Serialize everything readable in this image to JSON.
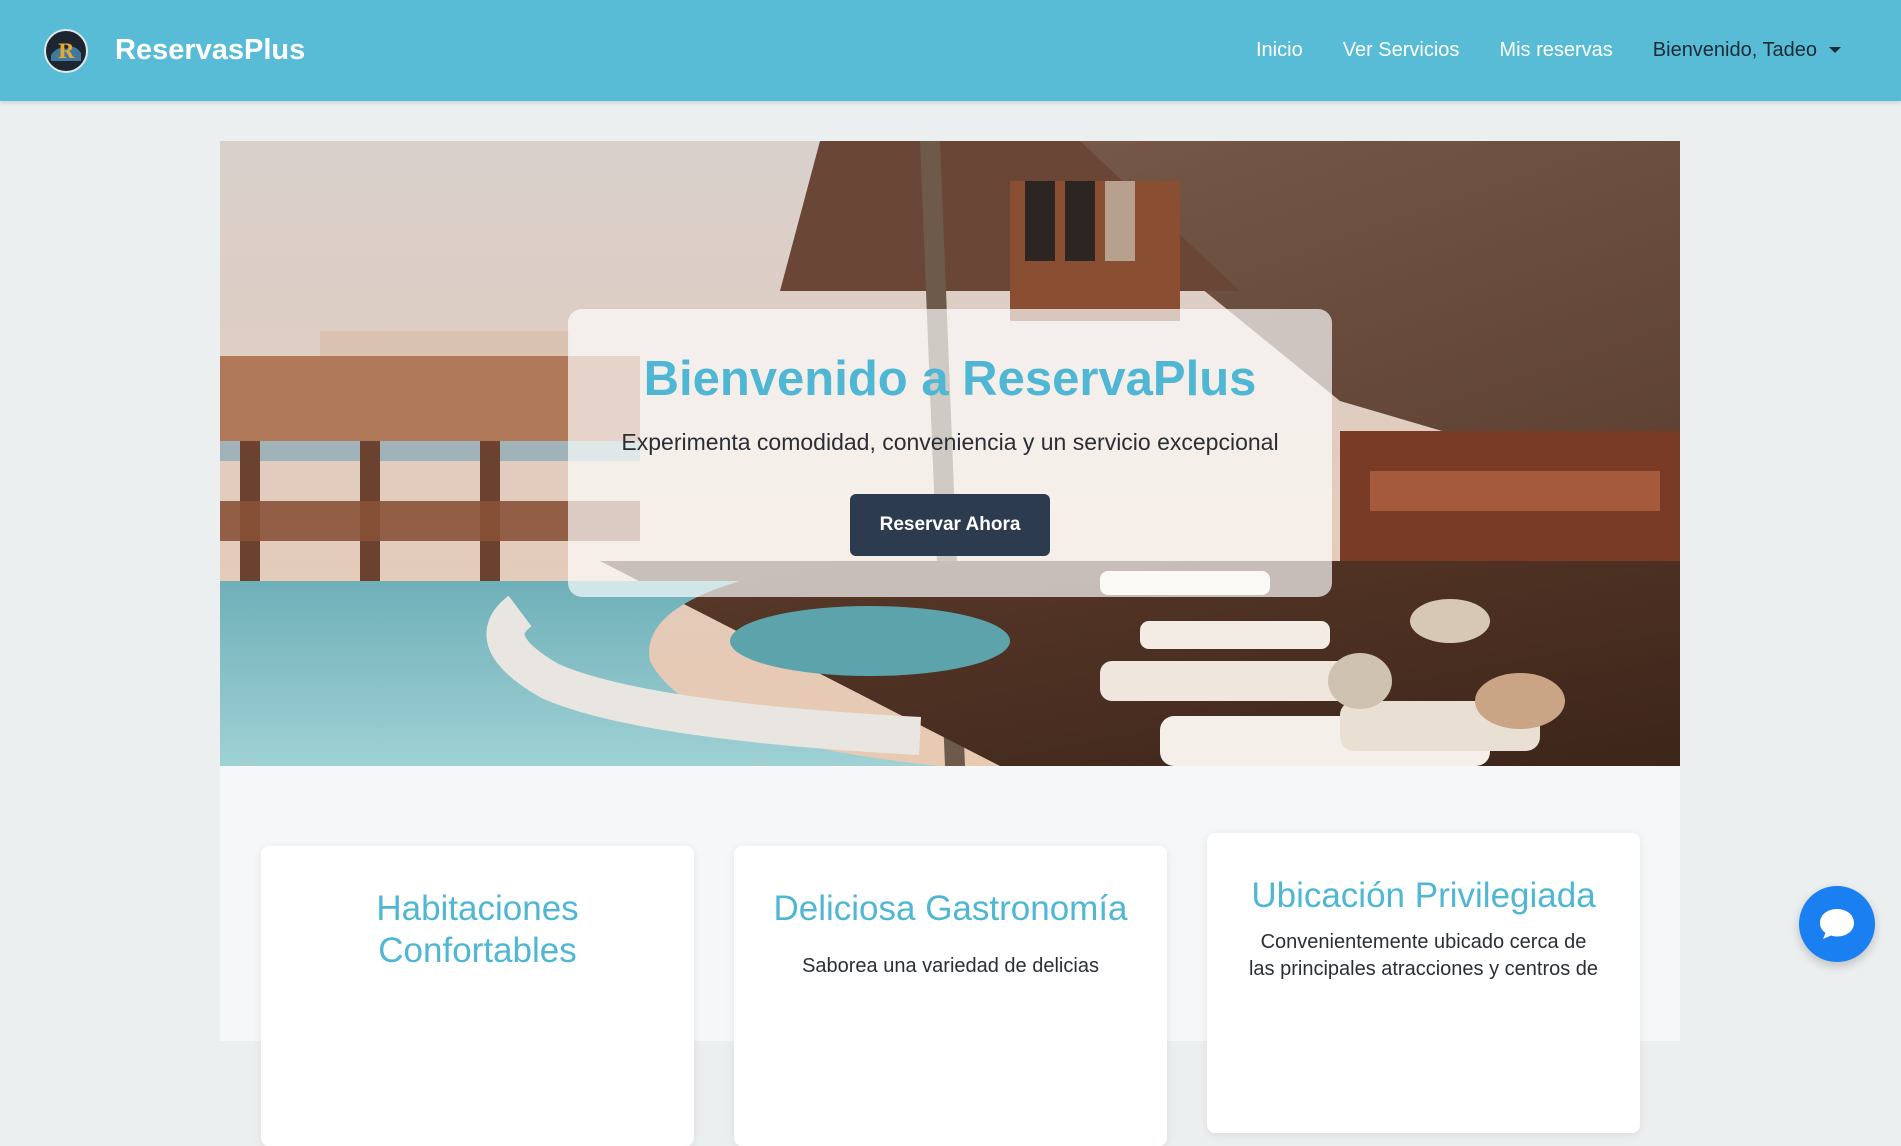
{
  "navbar": {
    "brand": "ReservasPlus",
    "logo_icon": "reservasplus-logo-icon",
    "links": [
      "Inicio",
      "Ver Servicios",
      "Mis reservas"
    ],
    "user_menu": "Bienvenido, Tadeo"
  },
  "hero": {
    "title": "Bienvenido a ReservaPlus",
    "subtitle": "Experimenta comodidad, conveniencia y un servicio excepcional",
    "button": "Reservar Ahora",
    "background_image": "resort pool and wooden lodge"
  },
  "features": [
    {
      "title": "Habitaciones Confortables",
      "text": ""
    },
    {
      "title": "Deliciosa Gastronomía",
      "text": "Saborea una variedad de delicias"
    },
    {
      "title": "Ubicación Privilegiada",
      "text": "Convenientemente ubicado cerca de las principales atracciones y centros de"
    }
  ],
  "chat": {
    "icon": "chat-bubble-icon"
  },
  "colors": {
    "navbar": "#58bcd6",
    "accent": "#4fb7d3",
    "button": "#2d3b4e",
    "chat": "#1a7ff0"
  }
}
